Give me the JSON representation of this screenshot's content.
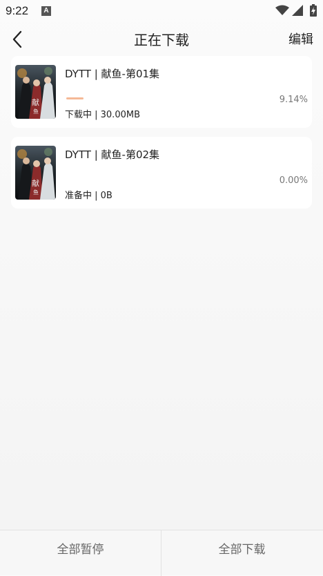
{
  "status_bar": {
    "time": "9:22",
    "notification_glyph": "A"
  },
  "header": {
    "title": "正在下载",
    "edit_label": "编辑"
  },
  "downloads": [
    {
      "title": "DYTT | 献鱼-第01集",
      "status": "下载中 | 30.00MB",
      "percent": "9.14%",
      "progress": 0.0914,
      "poster": "poster-image"
    },
    {
      "title": "DYTT | 献鱼-第02集",
      "status": "准备中 | 0B",
      "percent": "0.00%",
      "progress": 0,
      "poster": "poster-image"
    }
  ],
  "footer": {
    "pause_all_label": "全部暂停",
    "download_all_label": "全部下载"
  },
  "colors": {
    "progress": "#f5b996",
    "background": "#f6f6f6",
    "card": "#ffffff"
  }
}
